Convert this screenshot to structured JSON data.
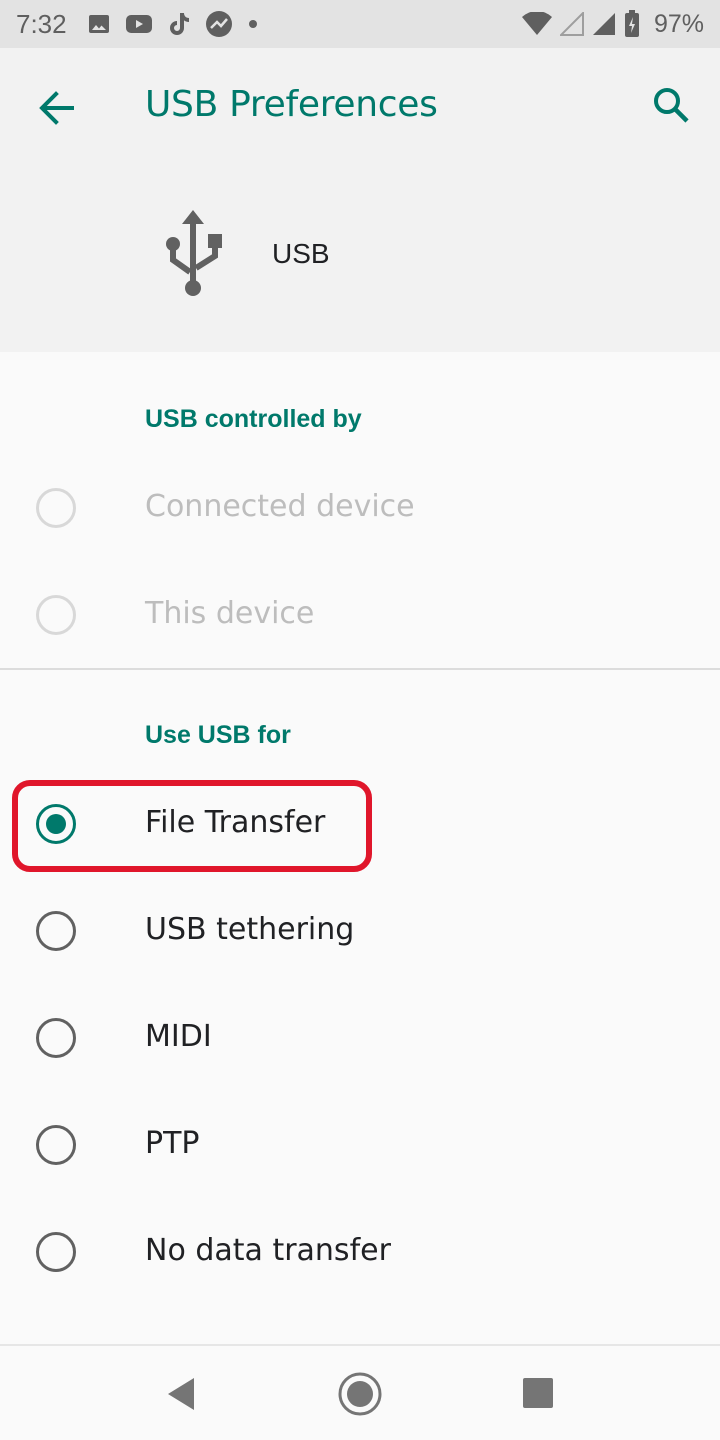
{
  "status_bar": {
    "time": "7:32",
    "battery": "97%",
    "left_icons": [
      "image-icon",
      "youtube-icon",
      "tiktok-icon",
      "trending-icon",
      "dot-icon"
    ],
    "right_icons": [
      "wifi-icon",
      "signal-empty-icon",
      "signal-icon",
      "battery-charging-icon"
    ]
  },
  "app_bar": {
    "title": "USB Preferences",
    "back_icon": "arrow-back-icon",
    "search_icon": "search-icon"
  },
  "header": {
    "icon": "usb-icon",
    "label": "USB"
  },
  "sections": {
    "controlled_by": {
      "title": "USB controlled by",
      "options": [
        {
          "label": "Connected device",
          "checked": false,
          "enabled": false
        },
        {
          "label": "This device",
          "checked": false,
          "enabled": false
        }
      ]
    },
    "use_for": {
      "title": "Use USB for",
      "options": [
        {
          "label": "File Transfer",
          "checked": true,
          "enabled": true
        },
        {
          "label": "USB tethering",
          "checked": false,
          "enabled": true
        },
        {
          "label": "MIDI",
          "checked": false,
          "enabled": true
        },
        {
          "label": "PTP",
          "checked": false,
          "enabled": true
        },
        {
          "label": "No data transfer",
          "checked": false,
          "enabled": true
        }
      ]
    }
  },
  "colors": {
    "accent": "#00796b",
    "highlight": "#e0162b",
    "disabled": "#bdbdbd"
  },
  "nav_bar": {
    "icons": [
      "nav-back-icon",
      "nav-home-icon",
      "nav-recents-icon"
    ]
  }
}
